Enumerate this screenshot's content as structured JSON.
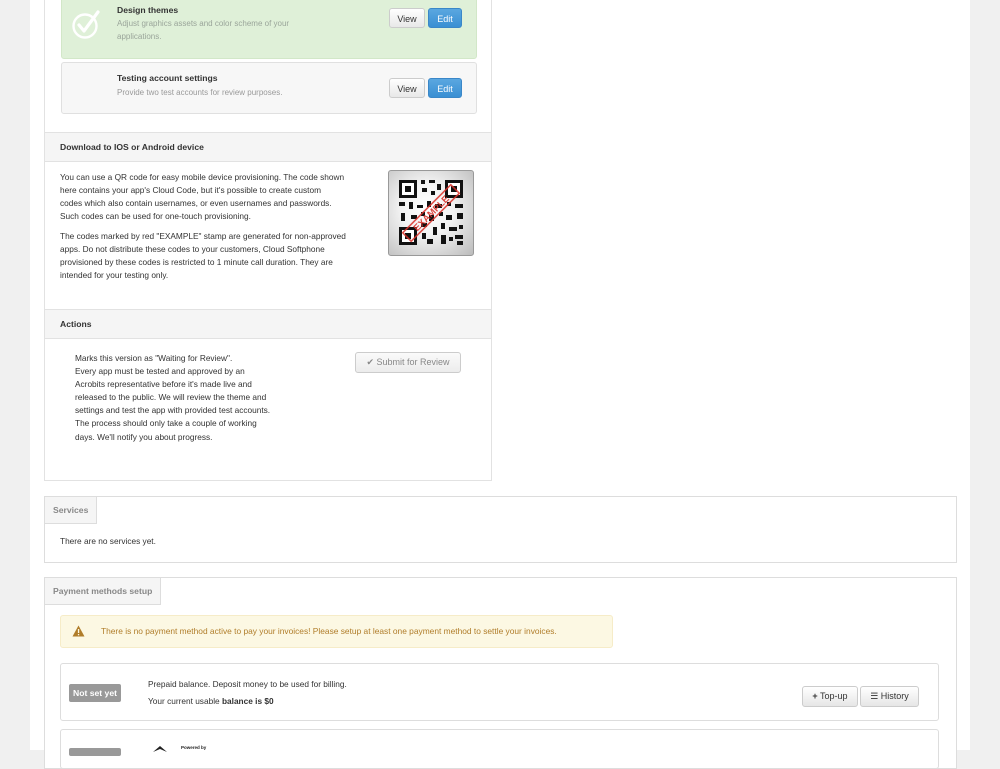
{
  "items": [
    {
      "title": "Design themes",
      "desc": "Adjust graphics assets and color scheme of your applications.",
      "view_label": "View",
      "edit_label": "Edit"
    },
    {
      "title": "Testing account settings",
      "desc": "Provide two test accounts for review purposes.",
      "view_label": "View",
      "edit_label": "Edit"
    }
  ],
  "download": {
    "title": "Download to IOS or Android device",
    "para1": "You can use a QR code for easy mobile device provisioning. The code shown here contains your app's Cloud Code, but it's possible to create custom codes which also contain usernames, or even usernames and passwords. Such codes can be used for one-touch provisioning.",
    "para2": "The codes marked by red \"EXAMPLE\" stamp are generated for non-approved apps. Do not distribute these codes to your customers, Cloud Softphone provisioned by these codes is restricted to 1 minute call duration. They are intended for your testing only.",
    "stamp": "EXAMPLE"
  },
  "actions": {
    "title": "Actions",
    "text1": "Marks this version as \"Waiting for Review\".",
    "text2": "Every app must be tested and approved by an Acrobits representative before it's made live and released to the public. We will review the theme and settings and test the app with provided test accounts.",
    "text3": "The process should only take a couple of working days. We'll notify you about progress.",
    "submit_label": "Submit for Review"
  },
  "services": {
    "tab": "Services",
    "empty": "There are no services yet."
  },
  "payment": {
    "tab": "Payment methods setup",
    "alert": "There is no payment method active to pay your invoices! Please setup at least one payment method to settle your invoices.",
    "status_badge": "Not set yet",
    "line1": "Prepaid balance. Deposit money to be used for billing.",
    "line2_prefix": "Your current usable ",
    "line2_bold": "balance is $0",
    "topup_label": "Top-up",
    "history_label": "History",
    "powered_by": "Powered by"
  },
  "colors": {
    "success_bg": "#dff0d8",
    "primary": "#3a8fd3",
    "warning_text": "#b07d2a",
    "stamp": "#d9342b"
  }
}
